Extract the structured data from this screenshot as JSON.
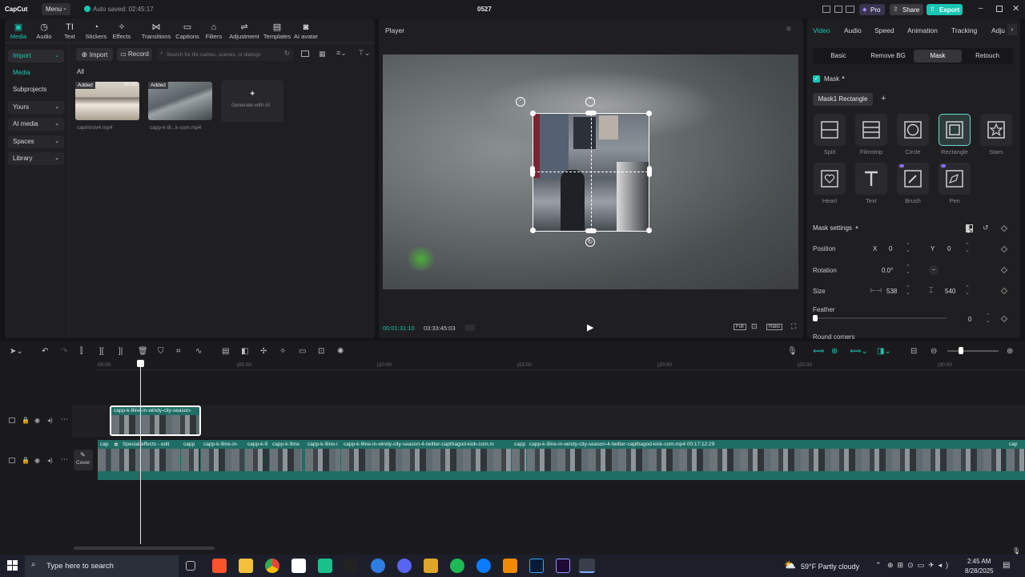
{
  "app": {
    "logo": "CapCut",
    "menu_label": "Menu",
    "autosave": "Auto saved: 02:45:17",
    "project_title": "0527",
    "pro_label": "Pro",
    "share_label": "Share",
    "export_label": "Export"
  },
  "media_tabs": [
    {
      "label": "Media",
      "icon": "media-icon"
    },
    {
      "label": "Audio",
      "icon": "audio-icon"
    },
    {
      "label": "Text",
      "icon": "text-icon"
    },
    {
      "label": "Stickers",
      "icon": "stickers-icon"
    },
    {
      "label": "Effects",
      "icon": "effects-icon"
    },
    {
      "label": "Transitions",
      "icon": "transitions-icon"
    },
    {
      "label": "Captions",
      "icon": "captions-icon"
    },
    {
      "label": "Filters",
      "icon": "filters-icon"
    },
    {
      "label": "Adjustment",
      "icon": "adjustment-icon"
    },
    {
      "label": "Templates",
      "icon": "templates-icon"
    },
    {
      "label": "AI avatar",
      "icon": "ai-avatar-icon"
    }
  ],
  "sidebar": [
    {
      "label": "Import"
    },
    {
      "label": "Media"
    },
    {
      "label": "Subprojects"
    },
    {
      "label": "Yours"
    },
    {
      "label": "AI media"
    },
    {
      "label": "Spaces"
    },
    {
      "label": "Library"
    }
  ],
  "media_toolbar": {
    "import_label": "Import",
    "record_label": "Record",
    "search_placeholder": "Search for file names, scenes, or dialogs",
    "filter_all": "All"
  },
  "media_items": [
    {
      "badge": "Added",
      "duration": "00:30",
      "name": "capintrov4.mp4"
    },
    {
      "badge": "Added",
      "duration": "",
      "name": "capp-k-9l...k-com.mp4"
    }
  ],
  "generate_ai_label": "Generate with AI",
  "player": {
    "title": "Player",
    "current_time": "00:01:31:10",
    "total_time": "03:33:45:03",
    "full_label": "Full",
    "ratio_label": "Ratio"
  },
  "inspector": {
    "tabs": [
      "Video",
      "Audio",
      "Speed",
      "Animation",
      "Tracking",
      "Adju"
    ],
    "subtabs": [
      "Basic",
      "Remove BG",
      "Mask",
      "Retouch"
    ],
    "mask_label": "Mask",
    "mask_chip": "Mask1 Rectangle",
    "shapes": [
      "Split",
      "Filmstrip",
      "Circle",
      "Rectangle",
      "Stars",
      "Heart",
      "Text",
      "Brush",
      "Pen"
    ],
    "mask_settings_label": "Mask settings",
    "position_label": "Position",
    "x_label": "X",
    "x_value": "0",
    "y_label": "Y",
    "y_value": "0",
    "rotation_label": "Rotation",
    "rotation_value": "0.0°",
    "size_label": "Size",
    "width_value": "538",
    "height_value": "540",
    "feather_label": "Feather",
    "feather_value": "0",
    "feather_level": 0,
    "round_corners_label": "Round corners"
  },
  "timeline": {
    "ticks": [
      "00:00",
      "|05:00",
      "|10:00",
      "|15:00",
      "|20:00",
      "|25:00",
      "|30:00"
    ],
    "overlay_clip_label": "capp-k-9ine-in-windy-city-season-",
    "main_clips": [
      "cap",
      "Special effects - edit",
      "capp",
      "capp-k-9ine-in-",
      "capp-k-9",
      "capp-k-9ine",
      "capp-k-9ine-i",
      "capp-k-9ine-in-windy-city-season-4-twitter-capthagod-kick-com.m",
      "capp",
      "capp-k-9ine-in-windy-city-season-4-twitter-capthagod-kick-com.mp4  00:17:12:29",
      "cap"
    ],
    "cover_label": "Cover"
  },
  "taskbar": {
    "search_placeholder": "Type here to search",
    "weather": "59°F  Partly cloudy",
    "time": "2:45 AM",
    "date": "8/28/2025"
  },
  "colors": {
    "accent": "#19c6b4",
    "selection": "#6ad9cf",
    "clip": "#1f6e66",
    "pro": "#6b4fd8"
  }
}
